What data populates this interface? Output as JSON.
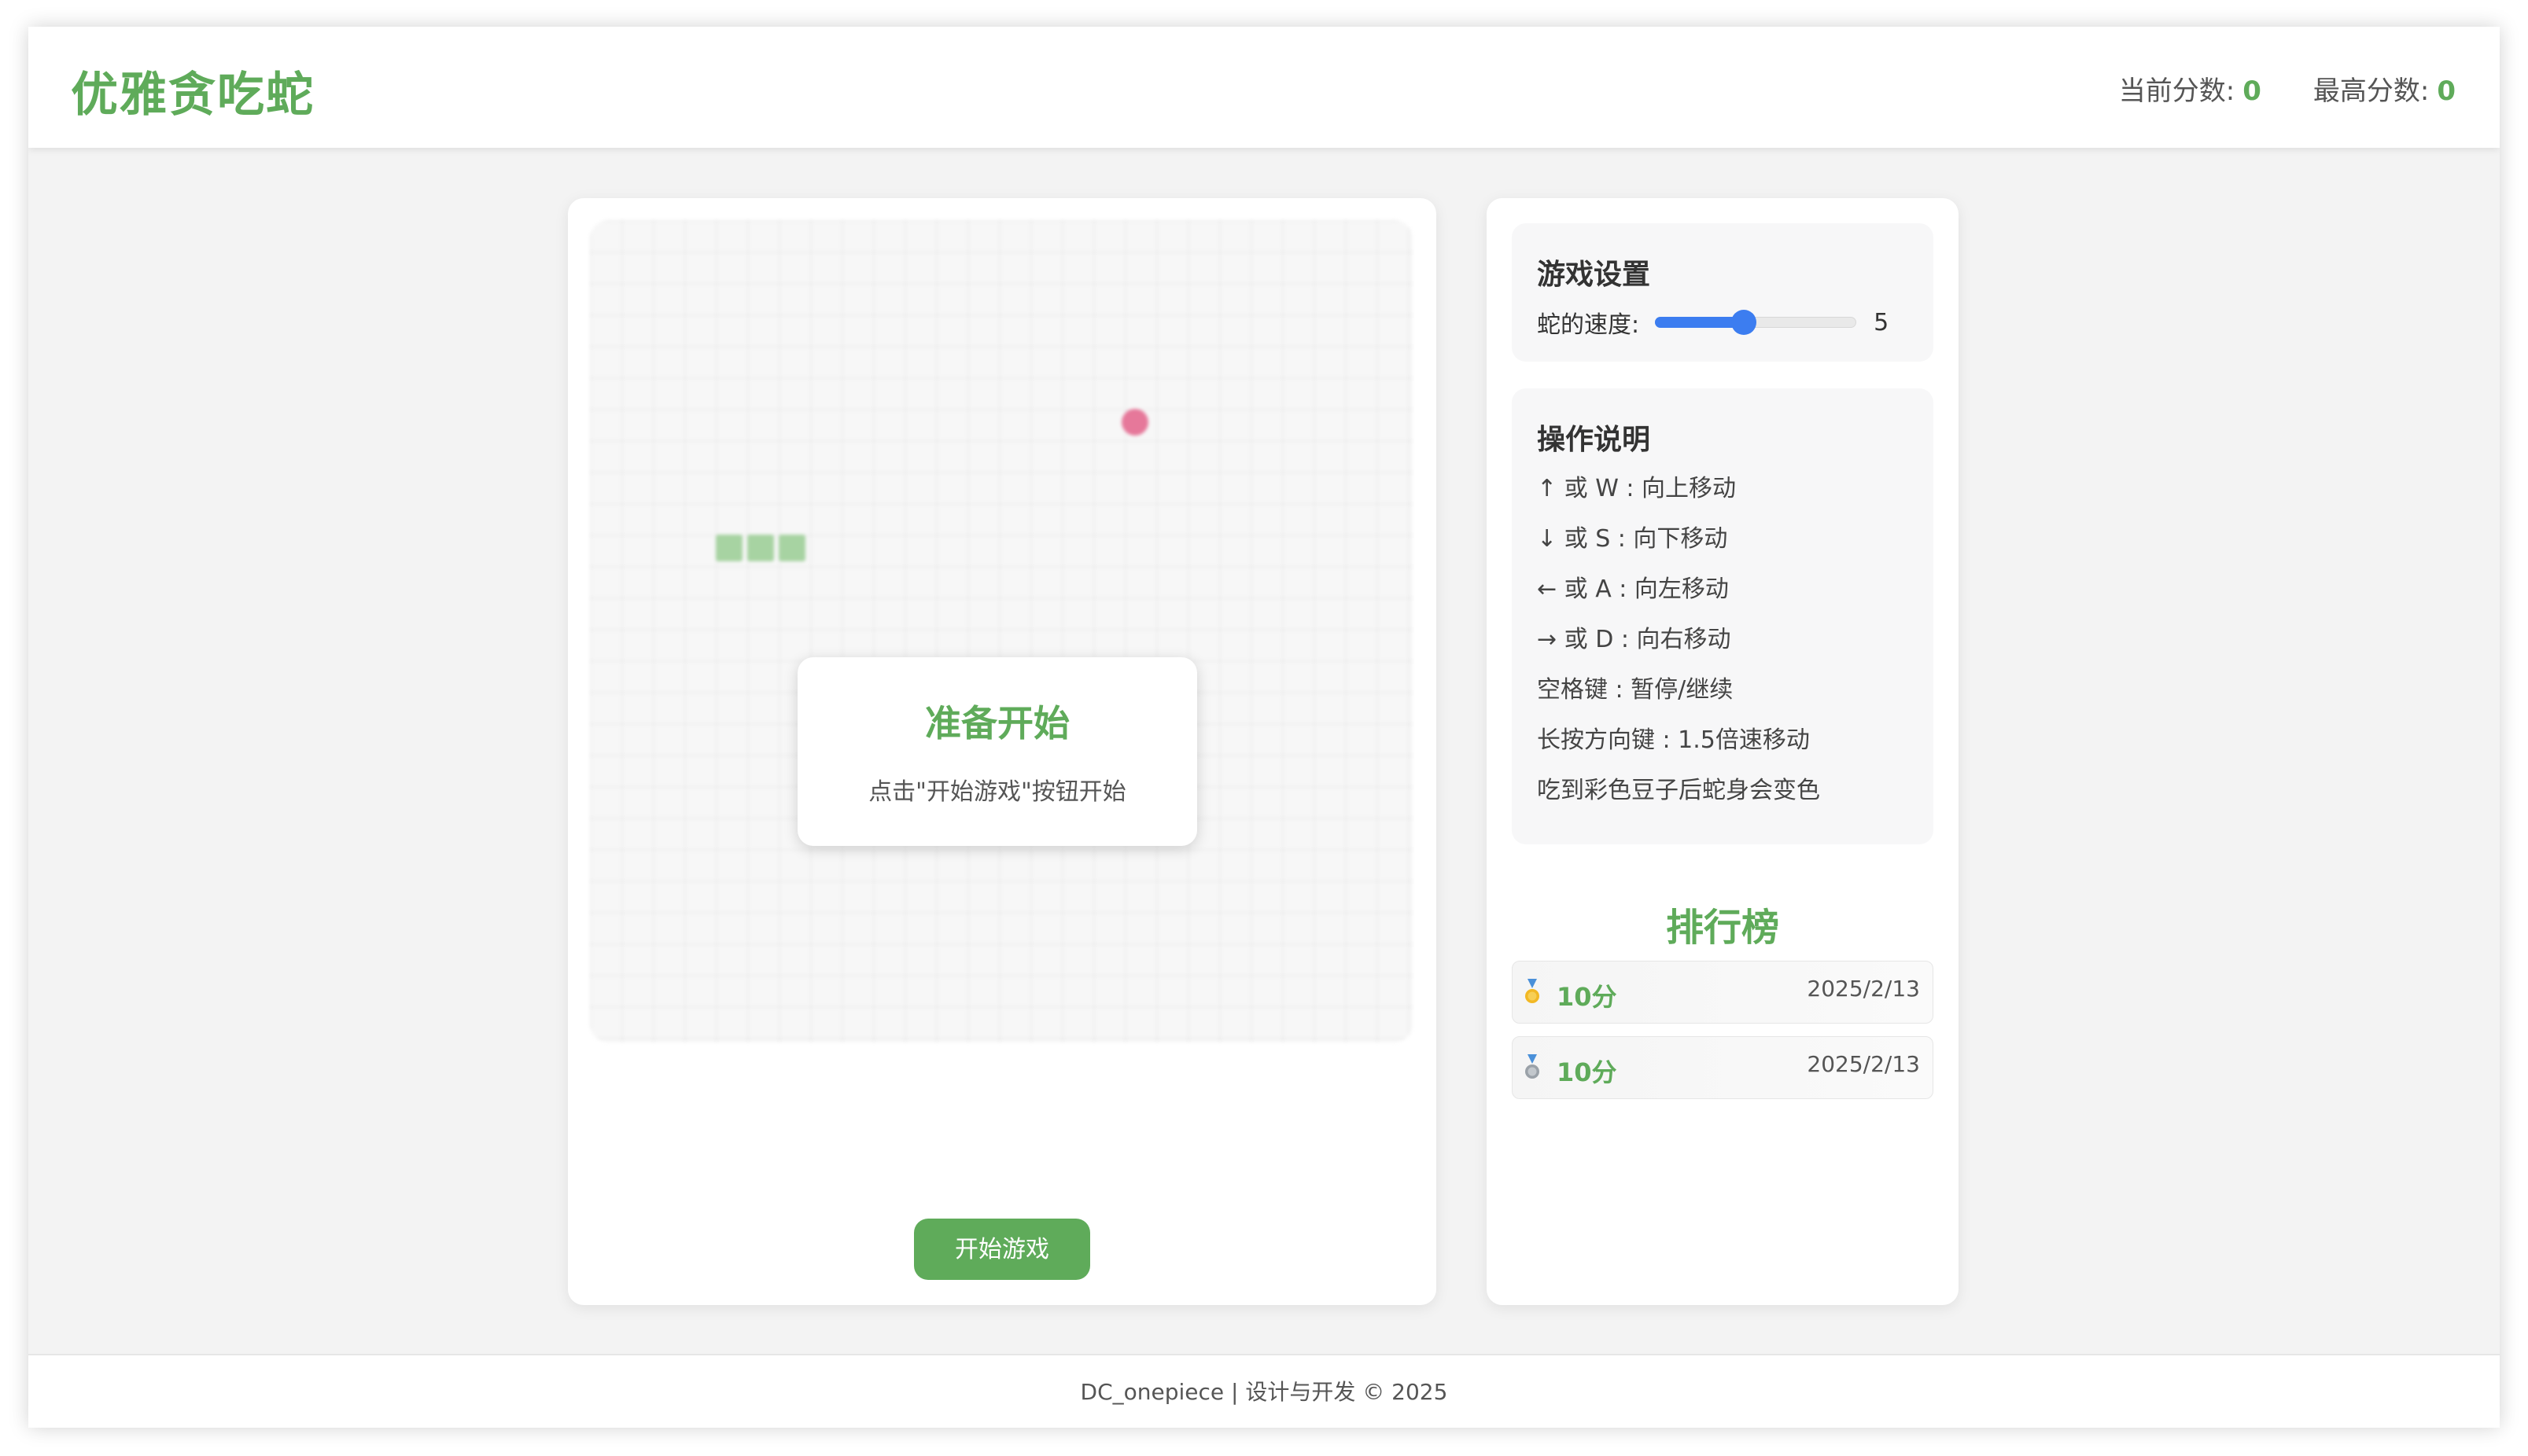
{
  "header": {
    "title": "优雅贪吃蛇",
    "current_score_label": "当前分数:",
    "current_score": "0",
    "high_score_label": "最高分数:",
    "high_score": "0"
  },
  "game": {
    "overlay_title": "准备开始",
    "overlay_text": "点击\"开始游戏\"按钮开始",
    "start_button": "开始游戏",
    "snake_color": "#a7d3a2",
    "food_color": "#e6789a",
    "accent": "#5fab5a"
  },
  "settings": {
    "title": "游戏设置",
    "speed_label": "蛇的速度:",
    "speed_value": "5",
    "speed_fraction": 0.44,
    "slider_color": "#3c7df0"
  },
  "help": {
    "title": "操作说明",
    "items": [
      "↑ 或 W : 向上移动",
      "↓ 或 S : 向下移动",
      "← 或 A : 向左移动",
      "→ 或 D : 向右移动",
      "空格键 : 暂停/继续",
      "长按方向键 : 1.5倍速移动",
      "吃到彩色豆子后蛇身会变色"
    ]
  },
  "leaderboard": {
    "title": "排行榜",
    "entries": [
      {
        "medal": "gold-medal-icon",
        "score": "10分",
        "date": "2025/2/13"
      },
      {
        "medal": "silver-medal-icon",
        "score": "10分",
        "date": "2025/2/13"
      }
    ]
  },
  "footer": {
    "text": "DC_onepiece | 设计与开发 © 2025"
  }
}
